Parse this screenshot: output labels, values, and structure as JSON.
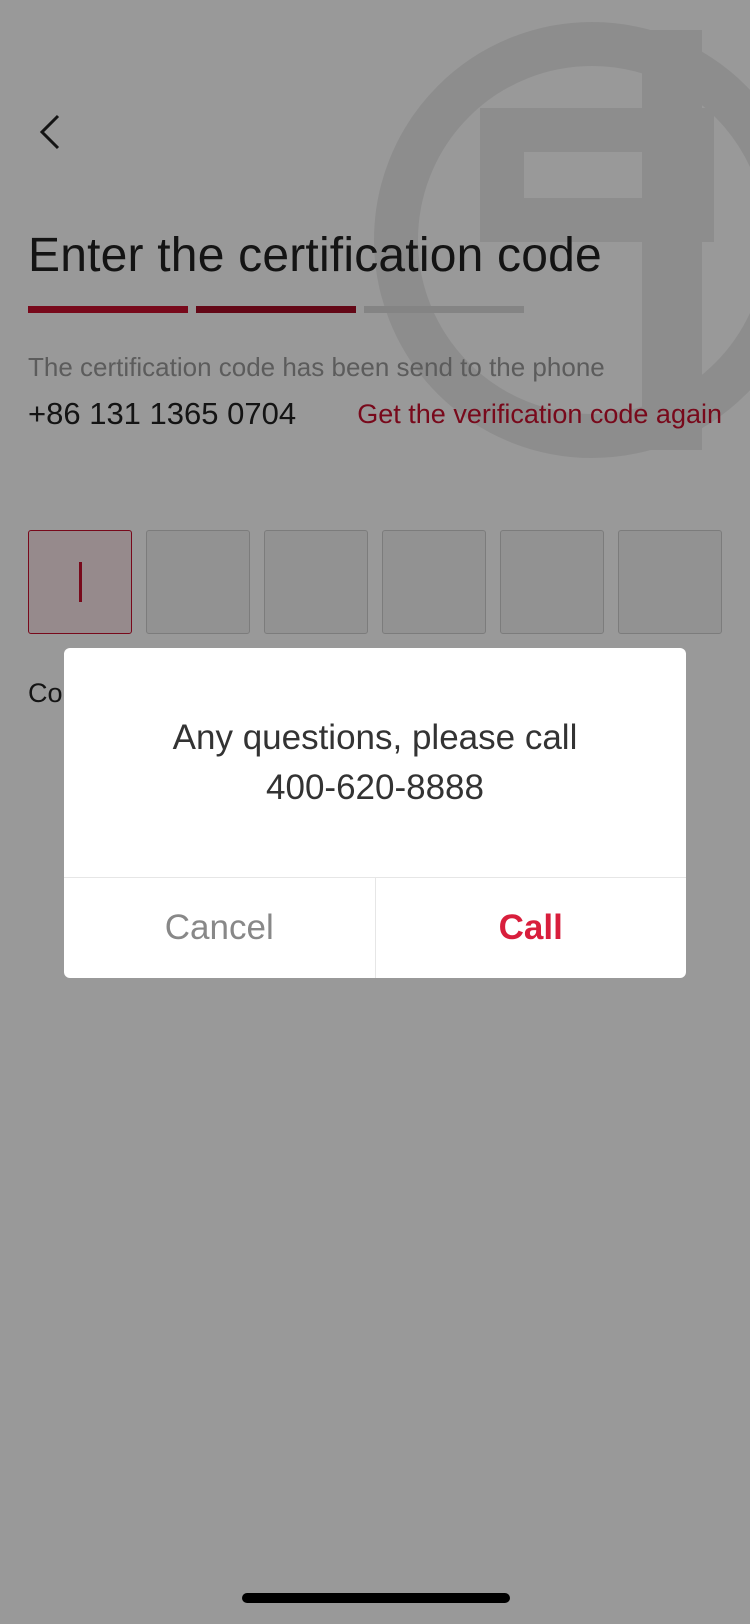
{
  "header": {
    "back_icon": "chevron-left-icon",
    "title": "Enter the certification code"
  },
  "progress": {
    "total_steps": 3,
    "current_step": 2
  },
  "verification": {
    "sent_text": "The certification code has been send to the phone",
    "phone": "+86 131 1365 0704",
    "resend_label": "Get the verification code  again"
  },
  "code_input": {
    "length": 6,
    "values": [
      "",
      "",
      "",
      "",
      "",
      ""
    ],
    "active_index": 0
  },
  "contact_hint": "Co",
  "dialog": {
    "message_line1": "Any questions, please call",
    "message_line2": "400-620-8888",
    "cancel_label": "Cancel",
    "call_label": "Call"
  },
  "colors": {
    "accent": "#c8102e",
    "call": "#d81e3c",
    "overlay": "rgba(0,0,0,0.40)"
  }
}
